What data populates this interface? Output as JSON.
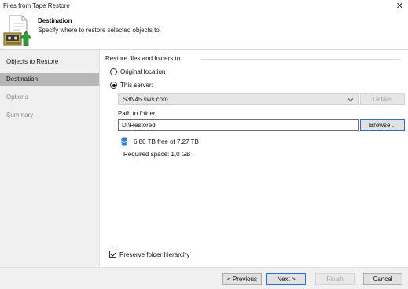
{
  "window": {
    "title": "Files from Tape Restore",
    "close_glyph": "✕"
  },
  "header": {
    "title": "Destination",
    "subtitle": "Specify where to restore selected objects to.",
    "icon": "tape-restore-icon"
  },
  "steps": [
    {
      "label": "Objects to Restore",
      "state": "done"
    },
    {
      "label": "Destination",
      "state": "active"
    },
    {
      "label": "Options",
      "state": "pending"
    },
    {
      "label": "Summary",
      "state": "pending"
    }
  ],
  "restore": {
    "section_label": "Restore files and folders to",
    "option_original": "Original location",
    "option_server": "This server:",
    "selected_option": "This server:",
    "server_value": "S3N45.sws.com",
    "details_label": "Details",
    "path_label": "Path to folder:",
    "path_value": "D:\\Restored",
    "browse_label": "Browse...",
    "free_space": "6,80 TB free of 7,27 TB",
    "required_space": "Required space:  1,0 GB",
    "preserve_label": "Preserve folder hierarchy",
    "preserve_checked": true
  },
  "buttons": {
    "previous": "< Previous",
    "next": "Next >",
    "finish": "Finish",
    "cancel": "Cancel"
  },
  "colors": {
    "active_step_bg": "#b7b7b7",
    "primary_border": "#2e6fc5",
    "icon_green": "#2e9b3c",
    "db_icon": "#2f7ad6"
  }
}
